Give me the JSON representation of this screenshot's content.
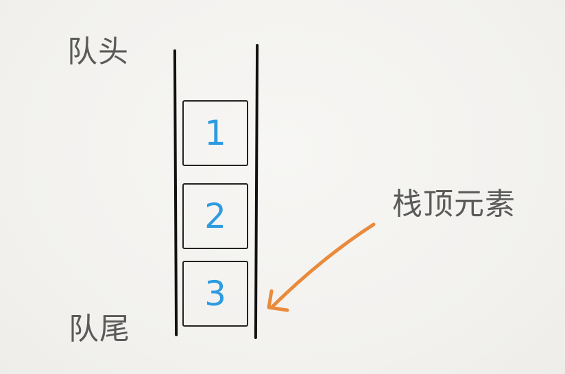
{
  "labels": {
    "queue_head": "队头",
    "queue_tail": "队尾",
    "stack_top": "栈顶元素"
  },
  "items": [
    {
      "value": "1"
    },
    {
      "value": "2"
    },
    {
      "value": "3"
    }
  ],
  "colors": {
    "number": "#2c9be0",
    "arrow": "#e98a3c",
    "label": "#5a5a5a"
  }
}
